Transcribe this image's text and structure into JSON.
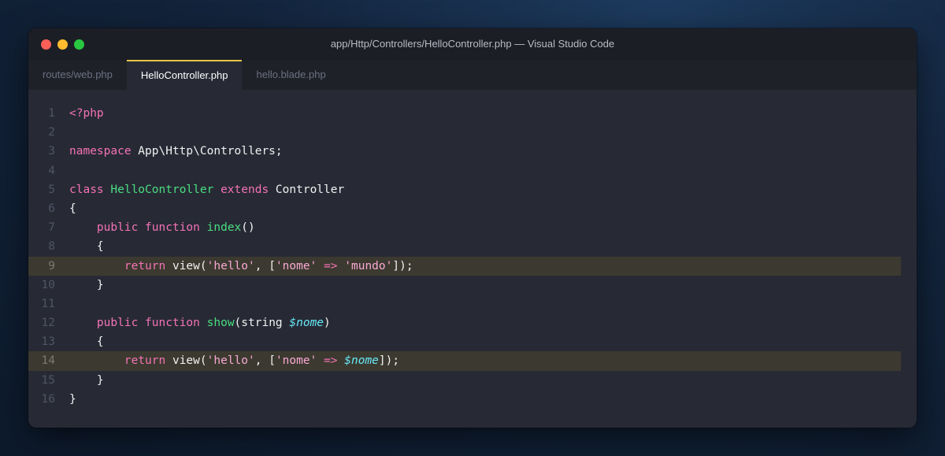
{
  "window": {
    "title": "app/Http/Controllers/HelloController.php — Visual Studio Code"
  },
  "tabs": [
    {
      "label": "routes/web.php",
      "active": false
    },
    {
      "label": "HelloController.php",
      "active": true
    },
    {
      "label": "hello.blade.php",
      "active": false
    }
  ],
  "colors": {
    "keyword": "#f472b6",
    "class_name": "#4ade80",
    "string": "#f9a8d4",
    "variable": "#67e8f9",
    "highlight_line": "#3c3a30",
    "active_tab_accent": "#e8c547"
  },
  "editor": {
    "lines": [
      {
        "number": "1",
        "highlight": false,
        "tokens": [
          {
            "t": "<?php",
            "c": "kw"
          }
        ]
      },
      {
        "number": "2",
        "highlight": false,
        "tokens": []
      },
      {
        "number": "3",
        "highlight": false,
        "tokens": [
          {
            "t": "namespace",
            "c": "kw"
          },
          {
            "t": " App\\Http\\Controllers;",
            "c": "plain"
          }
        ]
      },
      {
        "number": "4",
        "highlight": false,
        "tokens": []
      },
      {
        "number": "5",
        "highlight": false,
        "tokens": [
          {
            "t": "class",
            "c": "kw"
          },
          {
            "t": " ",
            "c": "plain"
          },
          {
            "t": "HelloController",
            "c": "cls"
          },
          {
            "t": " ",
            "c": "plain"
          },
          {
            "t": "extends",
            "c": "kw"
          },
          {
            "t": " Controller",
            "c": "plain"
          }
        ]
      },
      {
        "number": "6",
        "highlight": false,
        "tokens": [
          {
            "t": "{",
            "c": "plain"
          }
        ]
      },
      {
        "number": "7",
        "highlight": false,
        "tokens": [
          {
            "t": "    ",
            "c": "plain"
          },
          {
            "t": "public",
            "c": "kw"
          },
          {
            "t": " ",
            "c": "plain"
          },
          {
            "t": "function",
            "c": "kw"
          },
          {
            "t": " ",
            "c": "plain"
          },
          {
            "t": "index",
            "c": "fn"
          },
          {
            "t": "()",
            "c": "plain"
          }
        ]
      },
      {
        "number": "8",
        "highlight": false,
        "tokens": [
          {
            "t": "    {",
            "c": "plain"
          }
        ]
      },
      {
        "number": "9",
        "highlight": true,
        "tokens": [
          {
            "t": "        ",
            "c": "plain"
          },
          {
            "t": "return",
            "c": "kw"
          },
          {
            "t": " view(",
            "c": "plain"
          },
          {
            "t": "'hello'",
            "c": "str"
          },
          {
            "t": ", [",
            "c": "plain"
          },
          {
            "t": "'nome'",
            "c": "str"
          },
          {
            "t": " ",
            "c": "plain"
          },
          {
            "t": "=>",
            "c": "op"
          },
          {
            "t": " ",
            "c": "plain"
          },
          {
            "t": "'mundo'",
            "c": "str"
          },
          {
            "t": "]);",
            "c": "plain"
          }
        ]
      },
      {
        "number": "10",
        "highlight": false,
        "tokens": [
          {
            "t": "    }",
            "c": "plain"
          }
        ]
      },
      {
        "number": "11",
        "highlight": false,
        "tokens": []
      },
      {
        "number": "12",
        "highlight": false,
        "tokens": [
          {
            "t": "    ",
            "c": "plain"
          },
          {
            "t": "public",
            "c": "kw"
          },
          {
            "t": " ",
            "c": "plain"
          },
          {
            "t": "function",
            "c": "kw"
          },
          {
            "t": " ",
            "c": "plain"
          },
          {
            "t": "show",
            "c": "fn"
          },
          {
            "t": "(string ",
            "c": "plain"
          },
          {
            "t": "$nome",
            "c": "var"
          },
          {
            "t": ")",
            "c": "plain"
          }
        ]
      },
      {
        "number": "13",
        "highlight": false,
        "tokens": [
          {
            "t": "    {",
            "c": "plain"
          }
        ]
      },
      {
        "number": "14",
        "highlight": true,
        "tokens": [
          {
            "t": "        ",
            "c": "plain"
          },
          {
            "t": "return",
            "c": "kw"
          },
          {
            "t": " view(",
            "c": "plain"
          },
          {
            "t": "'hello'",
            "c": "str"
          },
          {
            "t": ", [",
            "c": "plain"
          },
          {
            "t": "'nome'",
            "c": "str"
          },
          {
            "t": " ",
            "c": "plain"
          },
          {
            "t": "=>",
            "c": "op"
          },
          {
            "t": " ",
            "c": "plain"
          },
          {
            "t": "$nome",
            "c": "var"
          },
          {
            "t": "]);",
            "c": "plain"
          }
        ]
      },
      {
        "number": "15",
        "highlight": false,
        "tokens": [
          {
            "t": "    }",
            "c": "plain"
          }
        ]
      },
      {
        "number": "16",
        "highlight": false,
        "tokens": [
          {
            "t": "}",
            "c": "plain"
          }
        ]
      }
    ]
  }
}
